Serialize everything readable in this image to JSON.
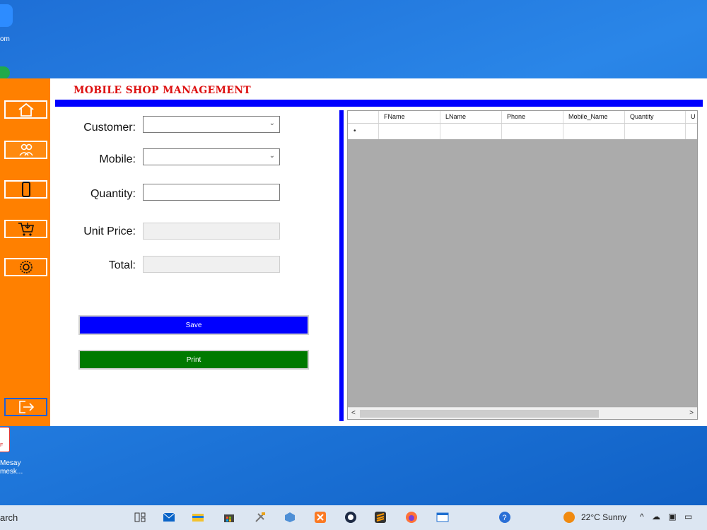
{
  "desktop": {
    "zoom_label": "om",
    "pdf_badge": "F",
    "pdf_label_line1": "Mesay",
    "pdf_label_line2": "mesk..."
  },
  "app": {
    "title": "MOBILE SHOP MANAGEMENT",
    "form": {
      "customer_label": "Customer:",
      "customer_value": "",
      "mobile_label": "Mobile:",
      "mobile_value": "",
      "quantity_label": "Quantity:",
      "quantity_value": "",
      "unit_price_label": "Unit Price:",
      "unit_price_value": "",
      "total_label": "Total:",
      "total_value": ""
    },
    "buttons": {
      "save": "Save",
      "print": "Print"
    },
    "grid": {
      "columns": [
        "FName",
        "LName",
        "Phone",
        "Mobile_Name",
        "Quantity",
        "U"
      ],
      "new_row_marker": "•"
    },
    "colors": {
      "sidebar": "#ff8000",
      "accent_blue": "#0000ff",
      "print_green": "#007a00",
      "title_red": "#dd1111"
    }
  },
  "taskbar": {
    "search_text": "arch",
    "weather": "22°C  Sunny"
  }
}
